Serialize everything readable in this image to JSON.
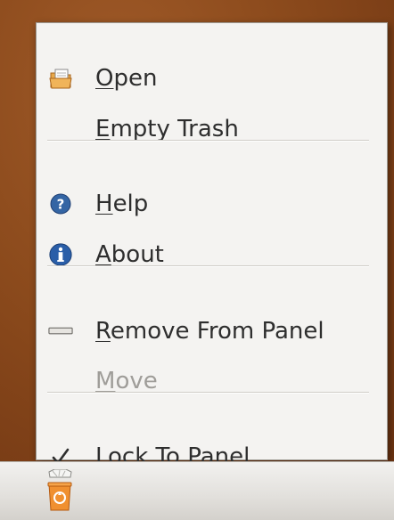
{
  "menu": {
    "items": [
      {
        "pre": "",
        "acc": "O",
        "post": "pen",
        "icon": "folder-open-icon",
        "disabled": false
      },
      {
        "pre": "",
        "acc": "E",
        "post": "mpty Trash",
        "icon": "",
        "disabled": false
      },
      {
        "pre": "",
        "acc": "H",
        "post": "elp",
        "icon": "help-icon",
        "disabled": false
      },
      {
        "pre": "",
        "acc": "A",
        "post": "bout",
        "icon": "about-icon",
        "disabled": false
      },
      {
        "pre": "",
        "acc": "R",
        "post": "emove From Panel",
        "icon": "remove-icon",
        "disabled": false
      },
      {
        "pre": "",
        "acc": "M",
        "post": "ove",
        "icon": "",
        "disabled": true
      },
      {
        "pre": "Loc",
        "acc": "k",
        "post": " To Panel",
        "icon": "checkmark-icon",
        "disabled": false,
        "checked": true
      }
    ]
  },
  "panel": {
    "applet_icon": "trash-can-icon"
  },
  "colors": {
    "desktop": "#8b4a1c",
    "menu_bg": "#f4f3f1",
    "text": "#2e2e2e",
    "disabled_text": "#9f9d99",
    "help_blue": "#3465a4"
  }
}
